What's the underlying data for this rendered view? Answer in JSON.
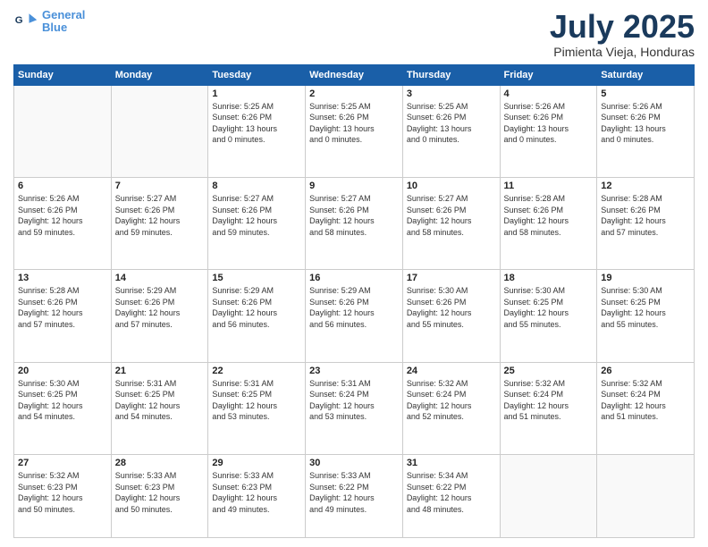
{
  "logo": {
    "line1": "General",
    "line2": "Blue"
  },
  "header": {
    "month": "July 2025",
    "location": "Pimienta Vieja, Honduras"
  },
  "weekdays": [
    "Sunday",
    "Monday",
    "Tuesday",
    "Wednesday",
    "Thursday",
    "Friday",
    "Saturday"
  ],
  "weeks": [
    [
      {
        "day": "",
        "info": ""
      },
      {
        "day": "",
        "info": ""
      },
      {
        "day": "1",
        "info": "Sunrise: 5:25 AM\nSunset: 6:26 PM\nDaylight: 13 hours\nand 0 minutes."
      },
      {
        "day": "2",
        "info": "Sunrise: 5:25 AM\nSunset: 6:26 PM\nDaylight: 13 hours\nand 0 minutes."
      },
      {
        "day": "3",
        "info": "Sunrise: 5:25 AM\nSunset: 6:26 PM\nDaylight: 13 hours\nand 0 minutes."
      },
      {
        "day": "4",
        "info": "Sunrise: 5:26 AM\nSunset: 6:26 PM\nDaylight: 13 hours\nand 0 minutes."
      },
      {
        "day": "5",
        "info": "Sunrise: 5:26 AM\nSunset: 6:26 PM\nDaylight: 13 hours\nand 0 minutes."
      }
    ],
    [
      {
        "day": "6",
        "info": "Sunrise: 5:26 AM\nSunset: 6:26 PM\nDaylight: 12 hours\nand 59 minutes."
      },
      {
        "day": "7",
        "info": "Sunrise: 5:27 AM\nSunset: 6:26 PM\nDaylight: 12 hours\nand 59 minutes."
      },
      {
        "day": "8",
        "info": "Sunrise: 5:27 AM\nSunset: 6:26 PM\nDaylight: 12 hours\nand 59 minutes."
      },
      {
        "day": "9",
        "info": "Sunrise: 5:27 AM\nSunset: 6:26 PM\nDaylight: 12 hours\nand 58 minutes."
      },
      {
        "day": "10",
        "info": "Sunrise: 5:27 AM\nSunset: 6:26 PM\nDaylight: 12 hours\nand 58 minutes."
      },
      {
        "day": "11",
        "info": "Sunrise: 5:28 AM\nSunset: 6:26 PM\nDaylight: 12 hours\nand 58 minutes."
      },
      {
        "day": "12",
        "info": "Sunrise: 5:28 AM\nSunset: 6:26 PM\nDaylight: 12 hours\nand 57 minutes."
      }
    ],
    [
      {
        "day": "13",
        "info": "Sunrise: 5:28 AM\nSunset: 6:26 PM\nDaylight: 12 hours\nand 57 minutes."
      },
      {
        "day": "14",
        "info": "Sunrise: 5:29 AM\nSunset: 6:26 PM\nDaylight: 12 hours\nand 57 minutes."
      },
      {
        "day": "15",
        "info": "Sunrise: 5:29 AM\nSunset: 6:26 PM\nDaylight: 12 hours\nand 56 minutes."
      },
      {
        "day": "16",
        "info": "Sunrise: 5:29 AM\nSunset: 6:26 PM\nDaylight: 12 hours\nand 56 minutes."
      },
      {
        "day": "17",
        "info": "Sunrise: 5:30 AM\nSunset: 6:26 PM\nDaylight: 12 hours\nand 55 minutes."
      },
      {
        "day": "18",
        "info": "Sunrise: 5:30 AM\nSunset: 6:25 PM\nDaylight: 12 hours\nand 55 minutes."
      },
      {
        "day": "19",
        "info": "Sunrise: 5:30 AM\nSunset: 6:25 PM\nDaylight: 12 hours\nand 55 minutes."
      }
    ],
    [
      {
        "day": "20",
        "info": "Sunrise: 5:30 AM\nSunset: 6:25 PM\nDaylight: 12 hours\nand 54 minutes."
      },
      {
        "day": "21",
        "info": "Sunrise: 5:31 AM\nSunset: 6:25 PM\nDaylight: 12 hours\nand 54 minutes."
      },
      {
        "day": "22",
        "info": "Sunrise: 5:31 AM\nSunset: 6:25 PM\nDaylight: 12 hours\nand 53 minutes."
      },
      {
        "day": "23",
        "info": "Sunrise: 5:31 AM\nSunset: 6:24 PM\nDaylight: 12 hours\nand 53 minutes."
      },
      {
        "day": "24",
        "info": "Sunrise: 5:32 AM\nSunset: 6:24 PM\nDaylight: 12 hours\nand 52 minutes."
      },
      {
        "day": "25",
        "info": "Sunrise: 5:32 AM\nSunset: 6:24 PM\nDaylight: 12 hours\nand 51 minutes."
      },
      {
        "day": "26",
        "info": "Sunrise: 5:32 AM\nSunset: 6:24 PM\nDaylight: 12 hours\nand 51 minutes."
      }
    ],
    [
      {
        "day": "27",
        "info": "Sunrise: 5:32 AM\nSunset: 6:23 PM\nDaylight: 12 hours\nand 50 minutes."
      },
      {
        "day": "28",
        "info": "Sunrise: 5:33 AM\nSunset: 6:23 PM\nDaylight: 12 hours\nand 50 minutes."
      },
      {
        "day": "29",
        "info": "Sunrise: 5:33 AM\nSunset: 6:23 PM\nDaylight: 12 hours\nand 49 minutes."
      },
      {
        "day": "30",
        "info": "Sunrise: 5:33 AM\nSunset: 6:22 PM\nDaylight: 12 hours\nand 49 minutes."
      },
      {
        "day": "31",
        "info": "Sunrise: 5:34 AM\nSunset: 6:22 PM\nDaylight: 12 hours\nand 48 minutes."
      },
      {
        "day": "",
        "info": ""
      },
      {
        "day": "",
        "info": ""
      }
    ]
  ]
}
